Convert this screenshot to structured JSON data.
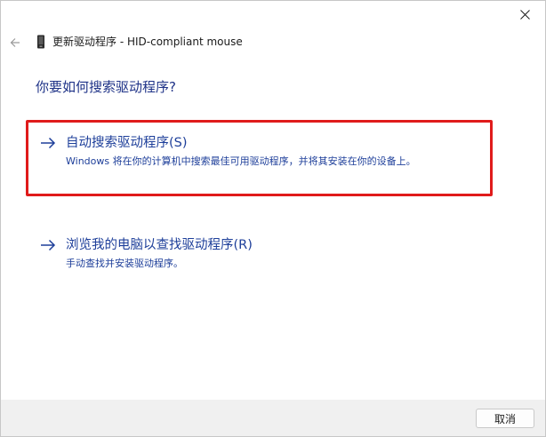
{
  "window": {
    "header_title": "更新驱动程序 - HID-compliant mouse"
  },
  "question": "你要如何搜索驱动程序?",
  "options": [
    {
      "title": "自动搜索驱动程序(S)",
      "description": "Windows 将在你的计算机中搜索最佳可用驱动程序，并将其安装在你的设备上。"
    },
    {
      "title": "浏览我的电脑以查找驱动程序(R)",
      "description": "手动查找并安装驱动程序。"
    }
  ],
  "footer": {
    "cancel_label": "取消"
  },
  "colors": {
    "link": "#1e3f9a",
    "heading": "#1e3287",
    "highlight": "#e01b1b",
    "footer_bg": "#f0f0f0"
  },
  "icons": {
    "close": "close-icon",
    "back": "arrow-left-icon",
    "device": "device-icon",
    "option": "arrow-right-icon"
  }
}
